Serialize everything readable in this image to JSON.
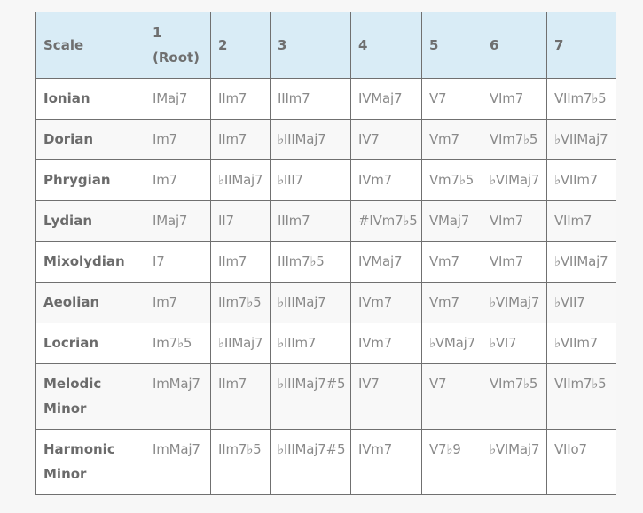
{
  "table": {
    "headers": [
      "Scale",
      "1\n(Root)",
      "2",
      "3",
      "4",
      "5",
      "6",
      "7"
    ],
    "header_lines": {
      "scale": "Scale",
      "root_num": "1",
      "root_label": "(Root)",
      "d2": "2",
      "d3": "3",
      "d4": "4",
      "d5": "5",
      "d6": "6",
      "d7": "7"
    },
    "rows": [
      {
        "scale": "Ionian",
        "chords": [
          "IMaj7",
          "IIm7",
          "IIIm7",
          "IVMaj7",
          "V7",
          "VIm7",
          "VIIm7♭5"
        ]
      },
      {
        "scale": "Dorian",
        "chords": [
          "Im7",
          "IIm7",
          "♭IIIMaj7",
          "IV7",
          "Vm7",
          "VIm7♭5",
          "♭VIIMaj7"
        ]
      },
      {
        "scale": "Phrygian",
        "chords": [
          "Im7",
          "♭IIMaj7",
          "♭III7",
          "IVm7",
          "Vm7♭5",
          "♭VIMaj7",
          "♭VIIm7"
        ]
      },
      {
        "scale": "Lydian",
        "chords": [
          "IMaj7",
          "II7",
          "IIIm7",
          "#IVm7♭5",
          "VMaj7",
          "VIm7",
          "VIIm7"
        ]
      },
      {
        "scale": "Mixolydian",
        "chords": [
          "I7",
          "IIm7",
          "IIIm7♭5",
          "IVMaj7",
          "Vm7",
          "VIm7",
          "♭VIIMaj7"
        ]
      },
      {
        "scale": "Aeolian",
        "chords": [
          "Im7",
          "IIm7♭5",
          "♭IIIMaj7",
          "IVm7",
          "Vm7",
          "♭VIMaj7",
          "♭VII7"
        ]
      },
      {
        "scale": "Locrian",
        "chords": [
          "Im7♭5",
          "♭IIMaj7",
          "♭IIIm7",
          "IVm7",
          "♭VMaj7",
          "♭VI7",
          "♭VIIm7"
        ]
      },
      {
        "scale": "Melodic Minor",
        "chords": [
          "ImMaj7",
          "IIm7",
          "♭IIIMaj7#5",
          "IV7",
          "V7",
          "VIm7♭5",
          "VIIm7♭5"
        ]
      },
      {
        "scale": "Harmonic Minor",
        "chords": [
          "ImMaj7",
          "IIm7♭5",
          "♭IIIMaj7#5",
          "IVm7",
          "V7♭9",
          "♭VIMaj7",
          "VIIo7"
        ]
      }
    ]
  },
  "colors": {
    "header_bg": "#d9ecf6",
    "border": "#707070",
    "scale_text": "#6b6b6b",
    "chord_text": "#8a8a8a",
    "page_bg": "#f7f7f7"
  }
}
